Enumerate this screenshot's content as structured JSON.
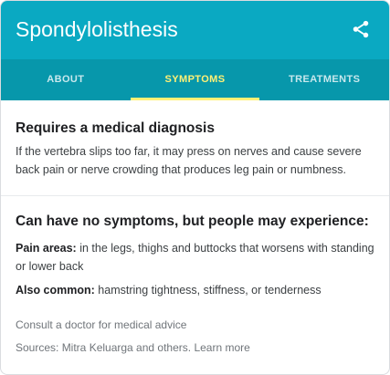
{
  "header": {
    "title": "Spondylolisthesis",
    "share_icon": "share-icon"
  },
  "tabs": [
    {
      "label": "ABOUT",
      "active": false
    },
    {
      "label": "SYMPTOMS",
      "active": true
    },
    {
      "label": "TREATMENTS",
      "active": false
    }
  ],
  "diagnosis": {
    "heading": "Requires a medical diagnosis",
    "body": "If the vertebra slips too far, it may press on nerves and cause severe back pain or nerve crowding that produces leg pain or numbness."
  },
  "symptoms": {
    "heading": "Can have no symptoms, but people may experience:",
    "pain_label": "Pain areas:",
    "pain_text": " in the legs, thighs and buttocks that worsens with standing or lower back",
    "common_label": "Also common:",
    "common_text": " hamstring tightness, stiffness, or tenderness"
  },
  "footer": {
    "consult": "Consult a doctor for medical advice",
    "sources_prefix": "Sources: Mitra Keluarga and others.",
    "learn_more": "Learn more"
  },
  "colors": {
    "header": "#0aa9c2",
    "tabs": "#0797ab",
    "active_tab": "#fff176"
  }
}
